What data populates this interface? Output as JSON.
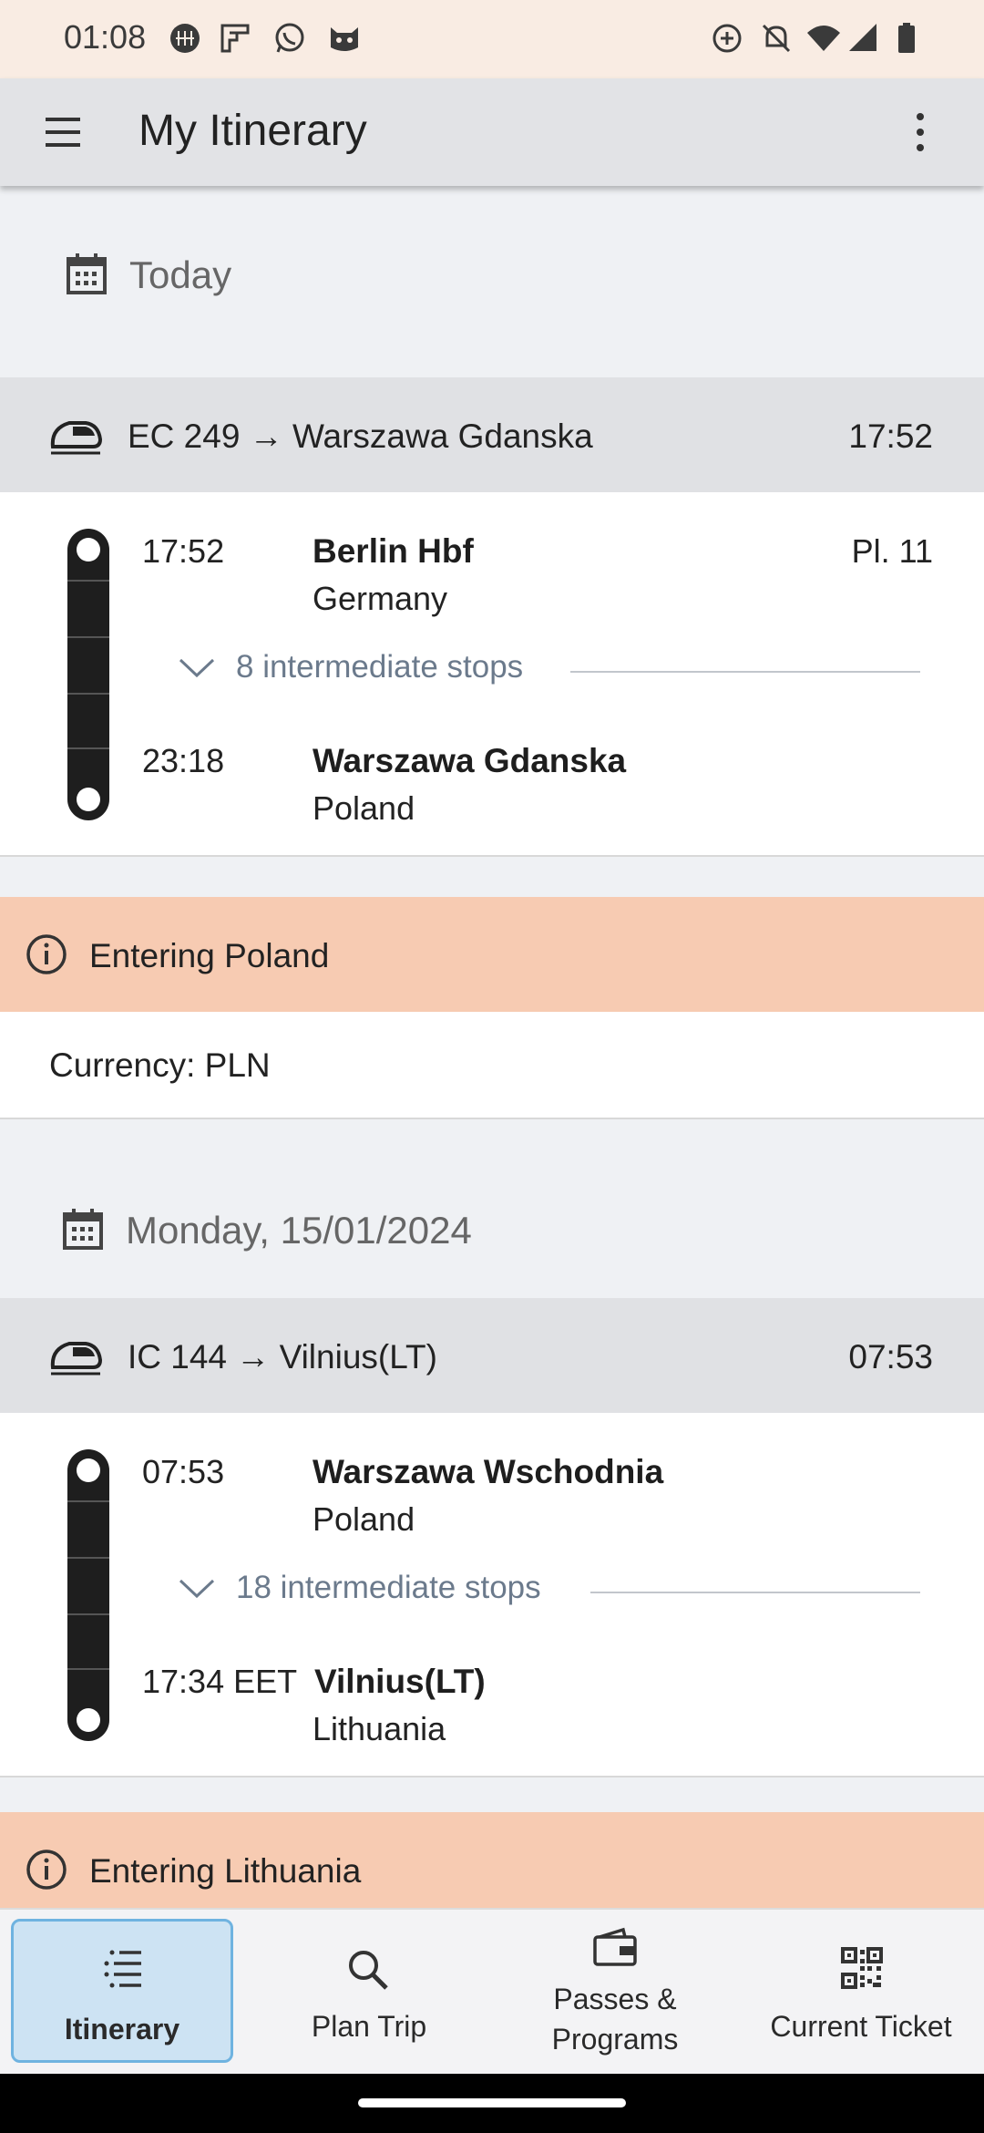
{
  "status_bar": {
    "time": "01:08"
  },
  "app_bar": {
    "title": "My Itinerary"
  },
  "sections": [
    {
      "date_label": "Today",
      "train": {
        "name": "EC 249",
        "arrow": "→",
        "destination": "Warszawa Gdanska",
        "time": "17:52"
      },
      "departure": {
        "time": "17:52",
        "station": "Berlin Hbf",
        "country": "Germany",
        "platform": "Pl. 11"
      },
      "intermediate": "8 intermediate stops",
      "arrival": {
        "time": "23:18",
        "station": "Warszawa Gdanska",
        "country": "Poland"
      },
      "notice": "Entering Poland",
      "currency": "Currency: PLN"
    },
    {
      "date_label": "Monday, 15/01/2024",
      "train": {
        "name": "IC 144",
        "arrow": "→",
        "destination": "Vilnius(LT)",
        "time": "07:53"
      },
      "departure": {
        "time": "07:53",
        "station": "Warszawa Wschodnia",
        "country": "Poland"
      },
      "intermediate": "18 intermediate stops",
      "arrival": {
        "time": "17:34 EET",
        "station": "Vilnius(LT)",
        "country": "Lithuania"
      },
      "notice": "Entering Lithuania"
    }
  ],
  "bottom_nav": [
    {
      "label": "Itinerary",
      "icon": "list-icon",
      "selected": true
    },
    {
      "label": "Plan Trip",
      "icon": "search-icon",
      "selected": false
    },
    {
      "label_line1": "Passes &",
      "label_line2": "Programs",
      "icon": "wallet-icon",
      "selected": false
    },
    {
      "label": "Current Ticket",
      "icon": "qr-code-icon",
      "selected": false
    }
  ],
  "colors": {
    "background": "#eff1f4",
    "app_bar": "#e2e3e6",
    "train_header": "#e0e1e4",
    "notice": "#f7cbb2",
    "nav_selected": "#cde3f3",
    "nav_selected_border": "#6fb3e0"
  }
}
